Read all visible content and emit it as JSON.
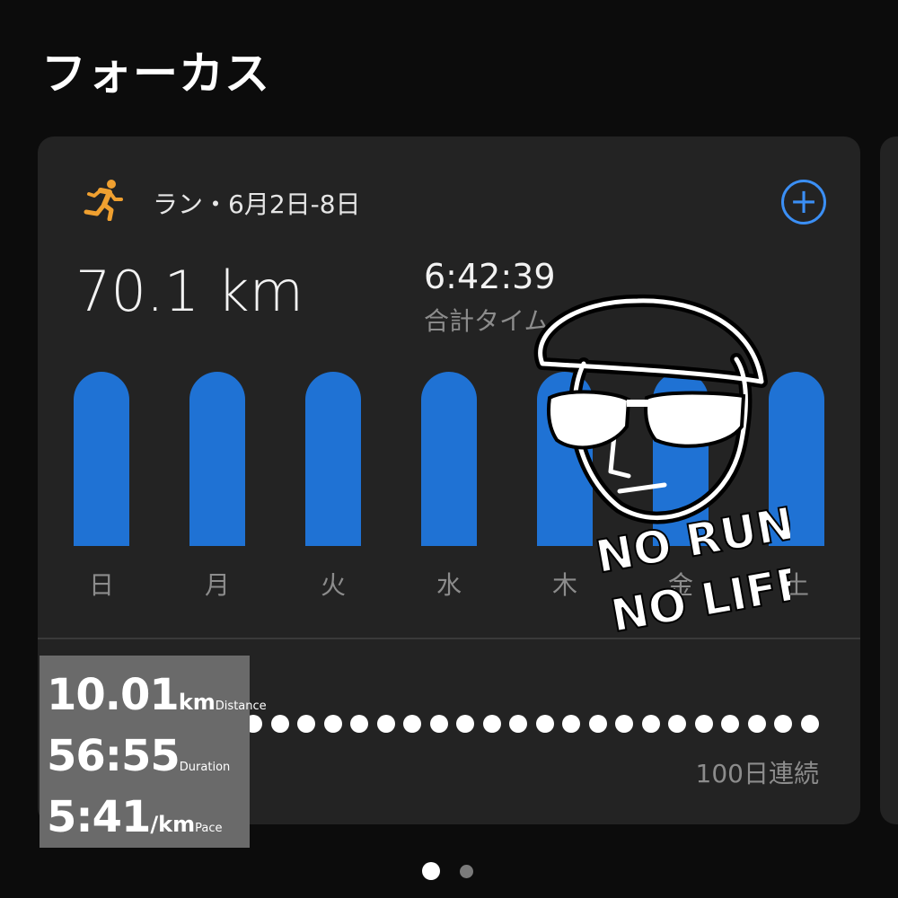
{
  "header": {
    "title": "フォーカス"
  },
  "card": {
    "activity_icon": "running-person-icon",
    "header_label": "ラン・6月2日-8日",
    "add_icon": "plus-circle-icon",
    "distance": "70.1 km",
    "total_time": "6:42:39",
    "total_time_label": "合計タイム",
    "bar_color": "#1f72d4",
    "days": [
      "日",
      "月",
      "火",
      "水",
      "木",
      "金",
      "土"
    ],
    "day_values": [
      1,
      1,
      1,
      1,
      1,
      1,
      1
    ],
    "streak_label": "100日連続"
  },
  "overlay_stats": {
    "distance_value": "10.01",
    "distance_unit": "km",
    "distance_label": "Distance",
    "duration_value": "56:55",
    "duration_label": "Duration",
    "pace_value": "5:41",
    "pace_unit": "/km",
    "pace_label": "Pace"
  },
  "sticker": {
    "text": "NO RUN NO LIFE"
  },
  "pagination": {
    "pages": 2,
    "active": 0
  },
  "colors": {
    "accent": "#3b8ff5",
    "icon_orange": "#f0a030",
    "background": "#0c0c0c",
    "card": "#232323"
  }
}
